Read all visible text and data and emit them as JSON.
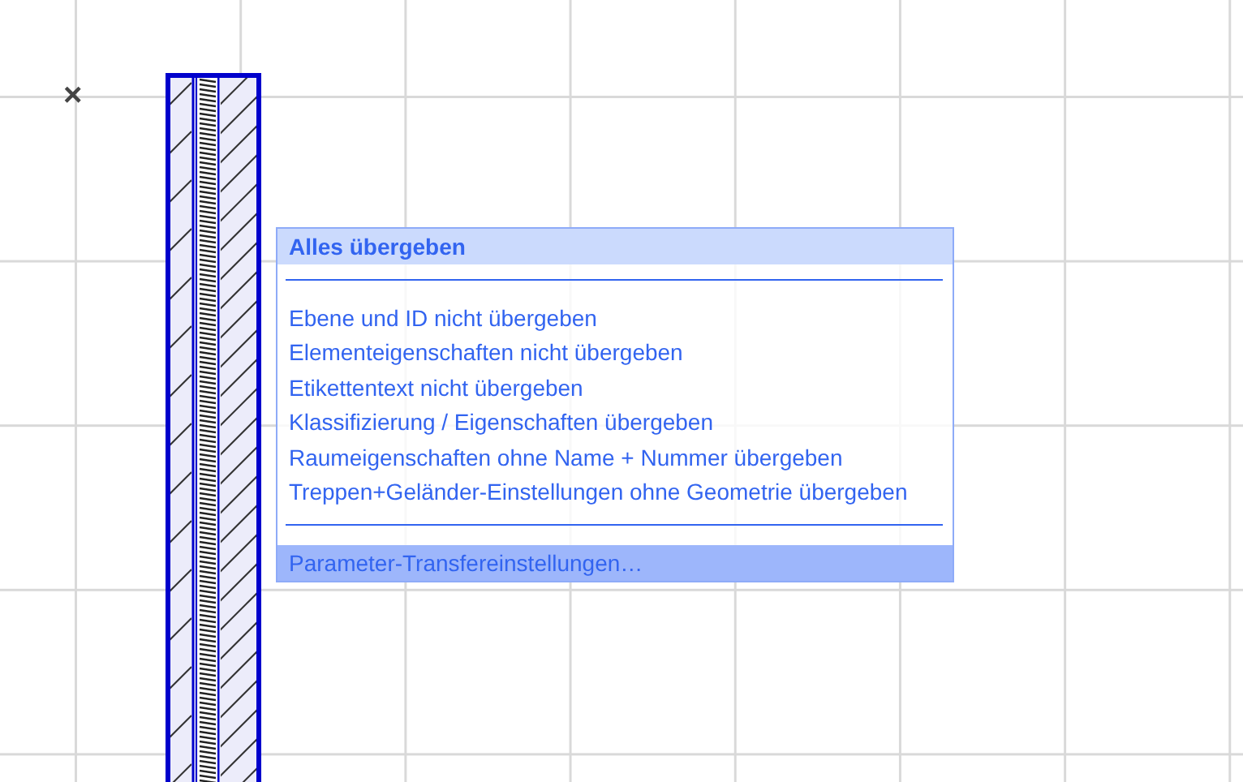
{
  "canvas": {
    "marker": "×"
  },
  "menu": {
    "items": [
      {
        "kind": "default",
        "label": "Alles übergeben",
        "selected": false
      },
      {
        "kind": "separator"
      },
      {
        "kind": "item",
        "label": "Ebene und ID nicht übergeben",
        "selected": false
      },
      {
        "kind": "item",
        "label": "Elementeigenschaften nicht übergeben",
        "selected": false
      },
      {
        "kind": "item",
        "label": "Etikettentext nicht übergeben",
        "selected": false
      },
      {
        "kind": "item",
        "label": "Klassifizierung / Eigenschaften übergeben",
        "selected": false
      },
      {
        "kind": "item",
        "label": "Raumeigenschaften ohne Name + Nummer übergeben",
        "selected": false
      },
      {
        "kind": "item",
        "label": "Treppen+Geländer-Einstellungen ohne Geometrie übergeben",
        "selected": false
      },
      {
        "kind": "separator"
      },
      {
        "kind": "item",
        "label": "Parameter-Transfereinstellungen…",
        "selected": true
      }
    ]
  }
}
